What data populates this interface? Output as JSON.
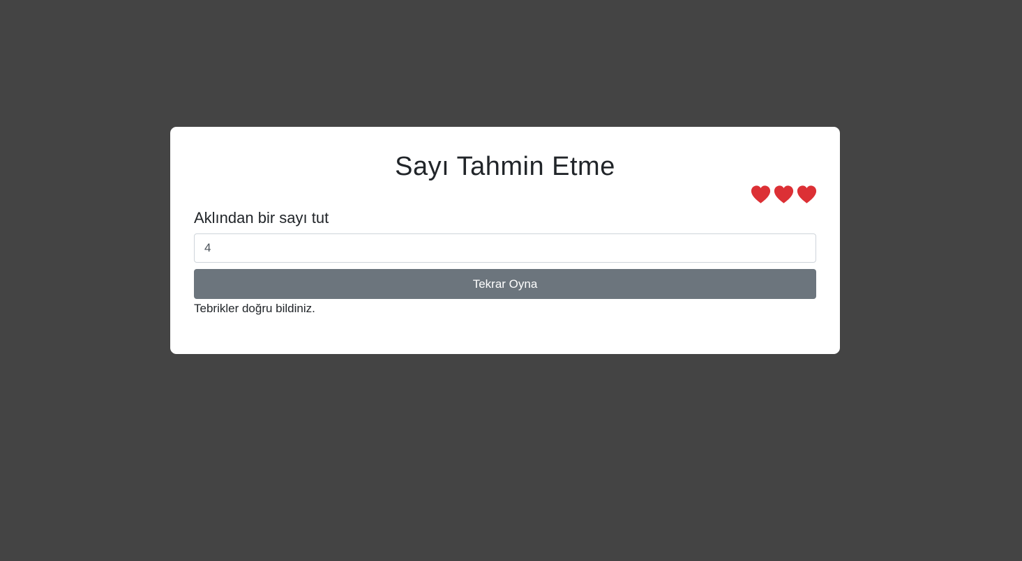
{
  "game": {
    "title": "Sayı Tahmin Etme",
    "lives": 3,
    "heart_icon": "heart-icon",
    "heart_color": "#dc3035",
    "prompt_label": "Aklından bir sayı tut",
    "guess_value": "4",
    "button_label": "Tekrar Oyna",
    "result_message": "Tebrikler doğru bildiniz."
  },
  "colors": {
    "background": "#444444",
    "card": "#ffffff",
    "button": "#6c757d",
    "text": "#212529"
  }
}
